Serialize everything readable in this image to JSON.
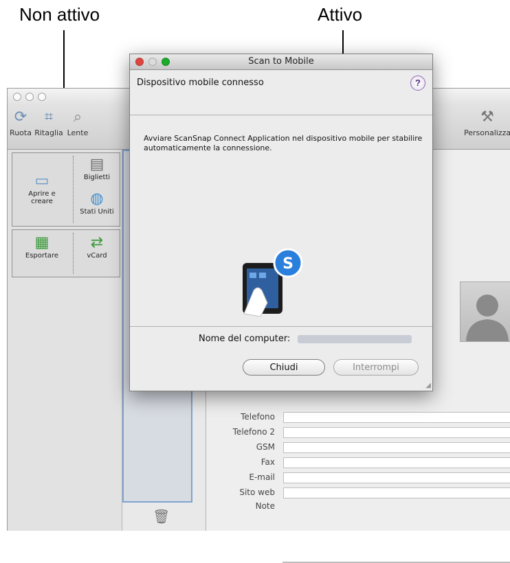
{
  "callouts": {
    "inactive": "Non attivo",
    "active": "Attivo"
  },
  "background_window": {
    "toolbar": {
      "rotate_label": "Ruota",
      "crop_label": "Ritaglia",
      "lens_label": "Lente",
      "customize_label": "Personalizza"
    },
    "groups": {
      "open_create": "Aprire e\ncreare",
      "cards": "Biglietti",
      "region": "Stati Uniti",
      "export": "Esportare",
      "vcard": "vCard"
    },
    "fields": [
      "Telefono",
      "Telefono 2",
      "GSM",
      "Fax",
      "E-mail",
      "Sito web",
      "Note"
    ]
  },
  "dialog": {
    "title": "Scan to Mobile",
    "header": "Dispositivo mobile connesso",
    "help_symbol": "?",
    "message": "Avviare ScanSnap Connect Application nel dispositivo mobile per stabilire automaticamente la connessione.",
    "computer_name_label": "Nome del computer:",
    "close_button": "Chiudi",
    "stop_button": "Interrompi"
  },
  "colors": {
    "tl_close": "#e0443e",
    "tl_min": "#dea123",
    "tl_zoom": "#1aab29",
    "accent_blue": "#3a7fd5"
  }
}
